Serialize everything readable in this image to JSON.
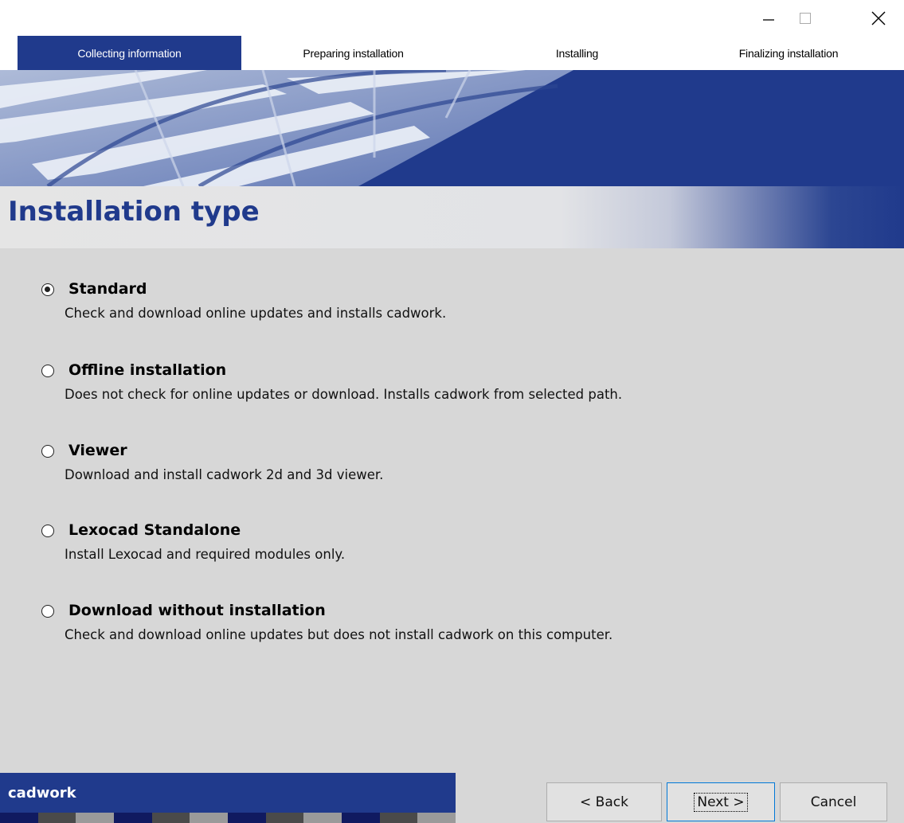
{
  "window": {
    "minimize_icon": "minimize-icon",
    "maximize_icon": "maximize-icon",
    "close_icon": "close-icon"
  },
  "steps": [
    {
      "label": "Collecting information",
      "active": true
    },
    {
      "label": "Preparing installation",
      "active": false
    },
    {
      "label": "Installing",
      "active": false
    },
    {
      "label": "Finalizing installation",
      "active": false
    }
  ],
  "heading": "Installation type",
  "options": [
    {
      "title": "Standard",
      "description": "Check and download online updates and installs cadwork.",
      "checked": true
    },
    {
      "title": "Offline installation",
      "description": "Does not check for online updates or download. Installs cadwork from selected path.",
      "checked": false
    },
    {
      "title": "Viewer",
      "description": "Download and install cadwork 2d and 3d viewer.",
      "checked": false
    },
    {
      "title": "Lexocad Standalone",
      "description": "Install Lexocad and required modules only.",
      "checked": false
    },
    {
      "title": "Download without installation",
      "description": "Check and download online updates but does not install cadwork on this computer.",
      "checked": false
    }
  ],
  "footer": {
    "brand": "cadwork",
    "back_label": "< Back",
    "next_label": "Next >",
    "cancel_label": "Cancel"
  },
  "colors": {
    "brand_blue": "#203a8c",
    "background": "#d7d7d7"
  }
}
